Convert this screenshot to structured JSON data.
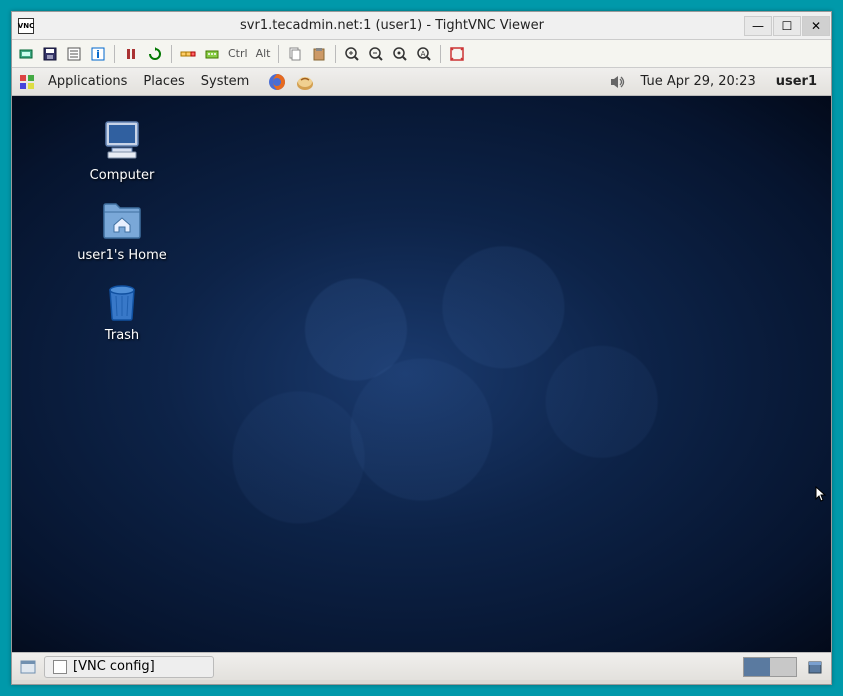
{
  "window": {
    "title": "svr1.tecadmin.net:1 (user1) - TightVNC Viewer"
  },
  "vnc_toolbar": {
    "ctrl": "Ctrl",
    "alt": "Alt"
  },
  "gnome_top": {
    "menus": [
      "Applications",
      "Places",
      "System"
    ],
    "clock": "Tue Apr 29, 20:23",
    "user": "user1"
  },
  "desktop_icons": [
    {
      "label": "Computer",
      "type": "computer"
    },
    {
      "label": "user1's Home",
      "type": "home"
    },
    {
      "label": "Trash",
      "type": "trash"
    }
  ],
  "taskbar": {
    "task": "[VNC config]"
  }
}
